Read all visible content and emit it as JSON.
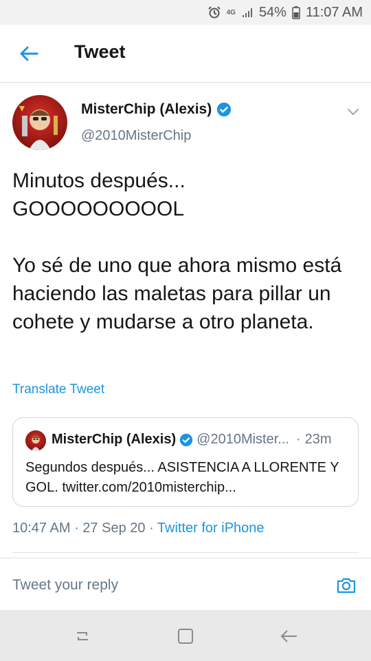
{
  "status_bar": {
    "network": "4G",
    "battery": "54%",
    "time": "11:07 AM",
    "icons": [
      "alarm-icon",
      "signal-icon",
      "battery-icon"
    ]
  },
  "header": {
    "title": "Tweet",
    "back_icon": "arrow-left-icon"
  },
  "tweet": {
    "author_name": "MisterChip (Alexis)",
    "author_handle": "@2010MisterChip",
    "text": "Minutos después...\nGOOOOOOOOOL\n\nYo sé de uno que ahora mismo está haciendo las maletas para pillar un cohete y mudarse a otro planeta.",
    "translate_label": "Translate Tweet",
    "time": "10:47 AM",
    "date": "27 Sep 20",
    "source": "Twitter for iPhone"
  },
  "quoted_tweet": {
    "author_name": "MisterChip (Alexis)",
    "author_handle": "@2010Mister...",
    "age": "23m",
    "text": "Segundos después... ASISTENCIA A LLORENTE Y GOL. twitter.com/2010misterchip..."
  },
  "reply": {
    "placeholder": "Tweet your reply",
    "camera_icon": "camera-icon"
  },
  "colors": {
    "accent": "#1b95e0",
    "text": "#14171a",
    "secondary": "#657786",
    "border": "#ccd6dd"
  }
}
